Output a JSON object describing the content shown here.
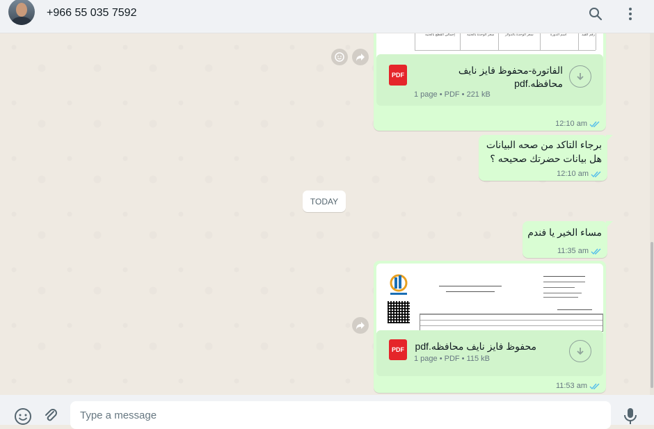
{
  "header": {
    "contact_name": "+966 55 035 7592",
    "search_icon": "search-icon",
    "menu_icon": "menu-dots-icon"
  },
  "messages": [
    {
      "type": "document",
      "file_name": "الفاتورة-محفوظ فايز نايف محافظه.pdf",
      "file_info": "1 page • PDF • 221 kB",
      "time": "12:10 am",
      "status": "read"
    },
    {
      "type": "text",
      "line1": "برجاء التاكد من صحه البيانات",
      "line2": "هل بيانات حضرتك صحيحه ؟",
      "time": "12:10 am",
      "status": "read"
    },
    {
      "type": "date",
      "label": "TODAY"
    },
    {
      "type": "text",
      "line1": "مساء الخير يا فندم",
      "time": "11:35 am",
      "status": "read"
    },
    {
      "type": "document",
      "file_name": "محفوظ فايز نايف محافظه.pdf",
      "file_info": "1 page • PDF • 115 kB",
      "time": "11:53 am",
      "status": "read"
    }
  ],
  "pdf_label": "PDF",
  "composer": {
    "placeholder": "Type a message"
  },
  "colors": {
    "outgoing_bubble": "#d9fdd3",
    "read_ticks": "#53bdeb",
    "pdf_red": "#e5252a"
  }
}
